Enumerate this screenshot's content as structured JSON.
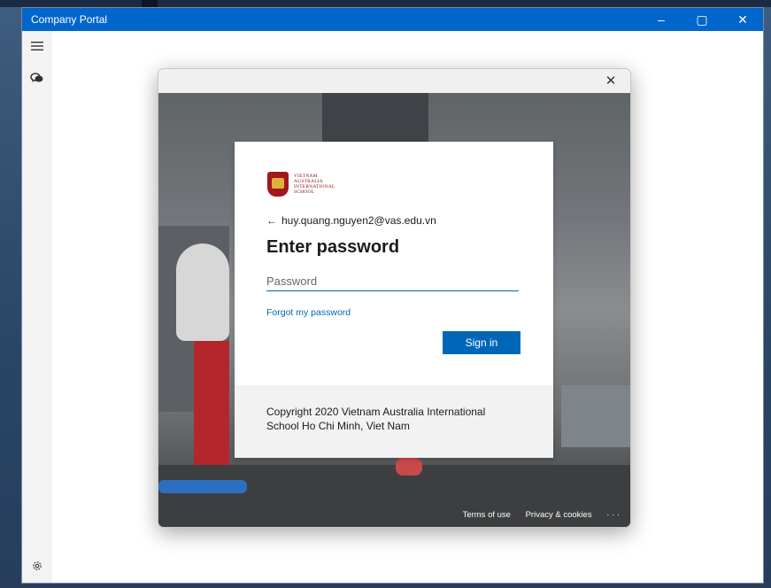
{
  "window": {
    "title": "Company Portal",
    "controls": {
      "minimize": "–",
      "maximize": "▢",
      "close": "✕"
    }
  },
  "sidebar": {
    "icons": [
      "hamburger-menu-icon",
      "chat-bubbles-icon",
      "settings-gear-icon"
    ]
  },
  "dialog": {
    "close": "✕",
    "logo": {
      "text": "VIETNAM\nAUSTRALIA\nINTERNATIONAL\nSCHOOL"
    },
    "account": "huy.quang.nguyen2@vas.edu.vn",
    "back_arrow": "←",
    "heading": "Enter password",
    "password_placeholder": "Password",
    "forgot_link": "Forgot my password",
    "signin_button": "Sign in",
    "copyright": "Copyright 2020 Vietnam Australia International School Ho Chi Minh, Viet Nam",
    "footer": {
      "terms": "Terms of use",
      "privacy": "Privacy & cookies",
      "more": "· · ·"
    }
  },
  "colors": {
    "titlebar": "#0066cc",
    "accent": "#0067b8"
  }
}
